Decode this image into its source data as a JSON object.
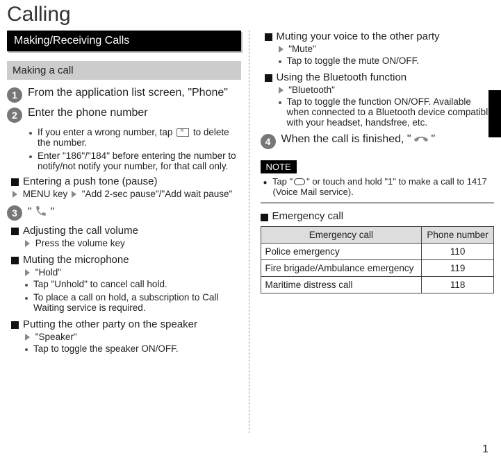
{
  "page_title": "Calling",
  "page_number": "1",
  "section1": {
    "title": "Making/Receiving Calls",
    "sub_title": "Making a call",
    "step1": {
      "title": "From the application list screen, \"Phone\""
    },
    "step2": {
      "title": "Enter the phone number",
      "b1": "If you enter a wrong number, tap ",
      "b1_after": " to delete the number.",
      "b2": "Enter \"186\"/\"184\" before entering the number to notify/not notify your number, for that call only."
    },
    "push_tone": {
      "head": "Entering a push tone (pause)",
      "line_a": " MENU key ",
      "line_b": " \"Add 2-sec pause\"/\"Add wait pause\""
    },
    "step3": {
      "prefix": "\" ",
      "suffix": " \""
    },
    "adjust": {
      "head": "Adjusting the call volume",
      "line": " Press the volume key"
    },
    "mute_mic": {
      "head": "Muting the microphone",
      "line": " \"Hold\"",
      "b1": "Tap \"Unhold\" to cancel call hold.",
      "b2": "To place a call on hold, a subscription to Call Waiting service is required."
    },
    "speaker": {
      "head": "Putting the other party on the speaker",
      "line": " \"Speaker\"",
      "b1": "Tap to toggle the speaker ON/OFF."
    }
  },
  "right": {
    "mute_voice": {
      "head": "Muting your voice to the other party",
      "line": " \"Mute\"",
      "b1": "Tap to toggle the mute ON/OFF."
    },
    "bluetooth": {
      "head": "Using the Bluetooth function",
      "line": " \"Bluetooth\"",
      "b1": "Tap to toggle the function ON/OFF. Available when connected to a Bluetooth device compatible with your headset, handsfree, etc."
    },
    "step4": {
      "prefix": "When the call is finished, \" ",
      "suffix": " \""
    },
    "note_label": "NOTE",
    "note_body": "Tap \"    \" or touch and hold \"1\" to make a call to 1417 (Voice Mail service).",
    "emergency": {
      "head": "Emergency call",
      "th1": "Emergency call",
      "th2": "Phone number",
      "rows": [
        {
          "name": "Police emergency",
          "num": "110"
        },
        {
          "name": "Fire brigade/Ambulance emergency",
          "num": "119"
        },
        {
          "name": "Maritime distress call",
          "num": "118"
        }
      ]
    }
  }
}
